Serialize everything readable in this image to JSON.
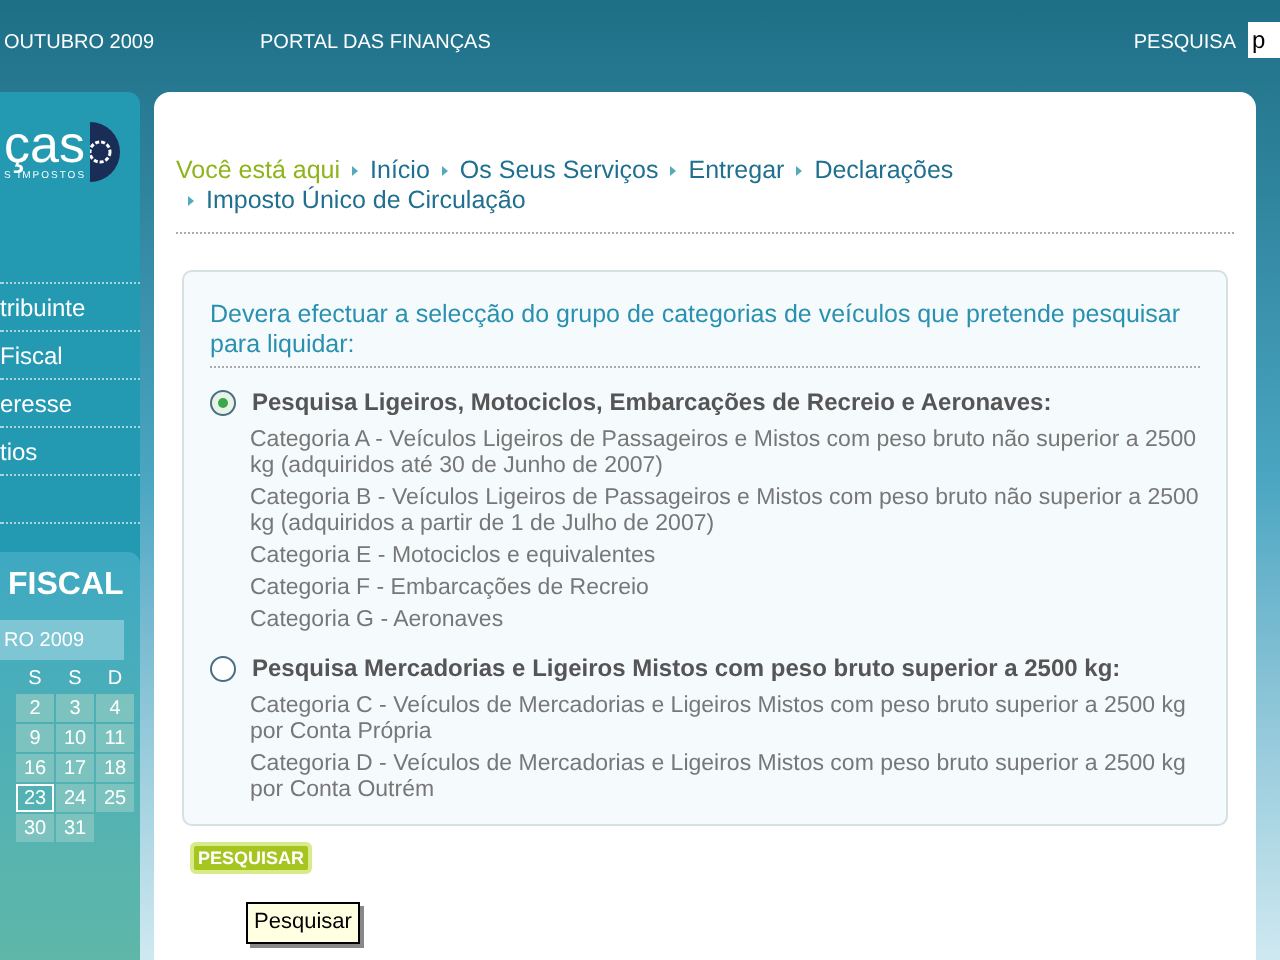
{
  "top_bar": {
    "date": "OUTUBRO 2009",
    "portal_link": "PORTAL DAS FINANÇAS",
    "search_label": "PESQUISA",
    "search_value": "p"
  },
  "sidebar": {
    "logo_text": "ças",
    "logo_subtitle": "S IMPOSTOS",
    "items": [
      "tribuinte",
      "Fiscal",
      "eresse",
      "tios"
    ],
    "calendar": {
      "title": "FISCAL",
      "month": "RO 2009",
      "weekdays": [
        "S",
        "S",
        "D"
      ],
      "weeks": [
        [
          {
            "day": "2",
            "selected": false
          },
          {
            "day": "3",
            "selected": false
          },
          {
            "day": "4",
            "selected": false
          }
        ],
        [
          {
            "day": "9",
            "selected": false
          },
          {
            "day": "10",
            "selected": false
          },
          {
            "day": "11",
            "selected": false
          }
        ],
        [
          {
            "day": "16",
            "selected": false
          },
          {
            "day": "17",
            "selected": false
          },
          {
            "day": "18",
            "selected": false
          }
        ],
        [
          {
            "day": "23",
            "selected": true
          },
          {
            "day": "24",
            "selected": false
          },
          {
            "day": "25",
            "selected": false
          }
        ],
        [
          {
            "day": "30",
            "selected": false
          },
          {
            "day": "31",
            "selected": false
          }
        ]
      ]
    }
  },
  "breadcrumb": {
    "label": "Você está aqui",
    "items": [
      "Início",
      "Os Seus Serviços",
      "Entregar",
      "Declarações",
      "Imposto Único de Circulação"
    ]
  },
  "form": {
    "question": "Devera efectuar a selecção do grupo de categorias de veículos que pretende pesquisar para liquidar:",
    "options": [
      {
        "label": "Pesquisa Ligeiros, Motociclos, Embarcações de Recreio e Aeronaves:",
        "selected": true,
        "categories": [
          "Categoria A - Veículos Ligeiros de Passageiros e Mistos com peso bruto não superior a 2500 kg (adquiridos até 30 de Junho de 2007)",
          "Categoria B - Veículos Ligeiros de Passageiros e Mistos com peso bruto não superior a 2500 kg (adquiridos a partir de 1 de Julho de 2007)",
          "Categoria E - Motociclos e equivalentes",
          "Categoria F - Embarcações de Recreio",
          "Categoria G - Aeronaves"
        ]
      },
      {
        "label": "Pesquisa Mercadorias e Ligeiros Mistos com peso bruto superior a 2500 kg:",
        "selected": false,
        "categories": [
          "Categoria C - Veículos de Mercadorias e Ligeiros Mistos com peso bruto superior a 2500 kg por Conta Própria",
          "Categoria D - Veículos de Mercadorias e Ligeiros Mistos com peso bruto superior a 2500 kg por Conta Outrém"
        ]
      }
    ],
    "submit": "PESQUISAR",
    "tooltip": "Pesquisar"
  }
}
